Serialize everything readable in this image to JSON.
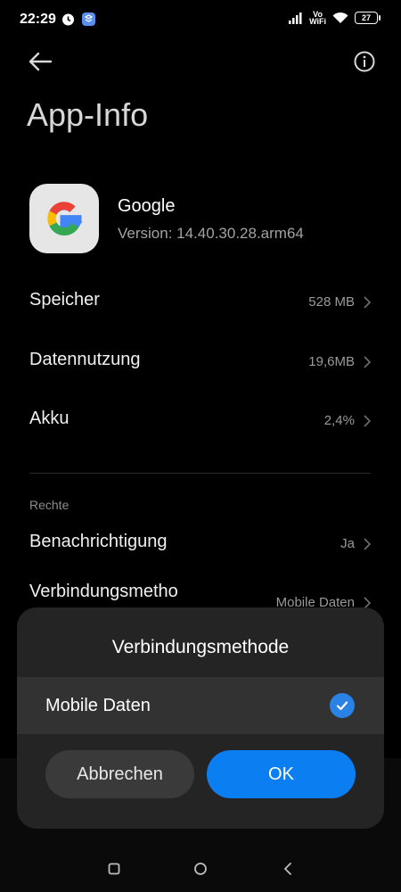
{
  "status_bar": {
    "time": "22:29",
    "network": "Vo\nWiFi",
    "battery": "27"
  },
  "header": {
    "title": "App-Info"
  },
  "app": {
    "name": "Google",
    "version": "Version: 14.40.30.28.arm64"
  },
  "rows": [
    {
      "label": "Speicher",
      "value": "528 MB"
    },
    {
      "label": "Datennutzung",
      "value": "19,6MB"
    },
    {
      "label": "Akku",
      "value": "2,4%"
    }
  ],
  "rights": {
    "section_label": "Rechte",
    "items": [
      {
        "label": "Benachrichtigung",
        "value": "Ja"
      },
      {
        "label": "Verbindungsmetho",
        "value": "Mobile Daten"
      }
    ]
  },
  "dialog": {
    "title": "Verbindungsmethode",
    "option_label": "Mobile Daten",
    "cancel_label": "Abbrechen",
    "ok_label": "OK"
  },
  "colors": {
    "accent": "#0b7ef2",
    "background": "#000000",
    "dialog": "#242424"
  }
}
